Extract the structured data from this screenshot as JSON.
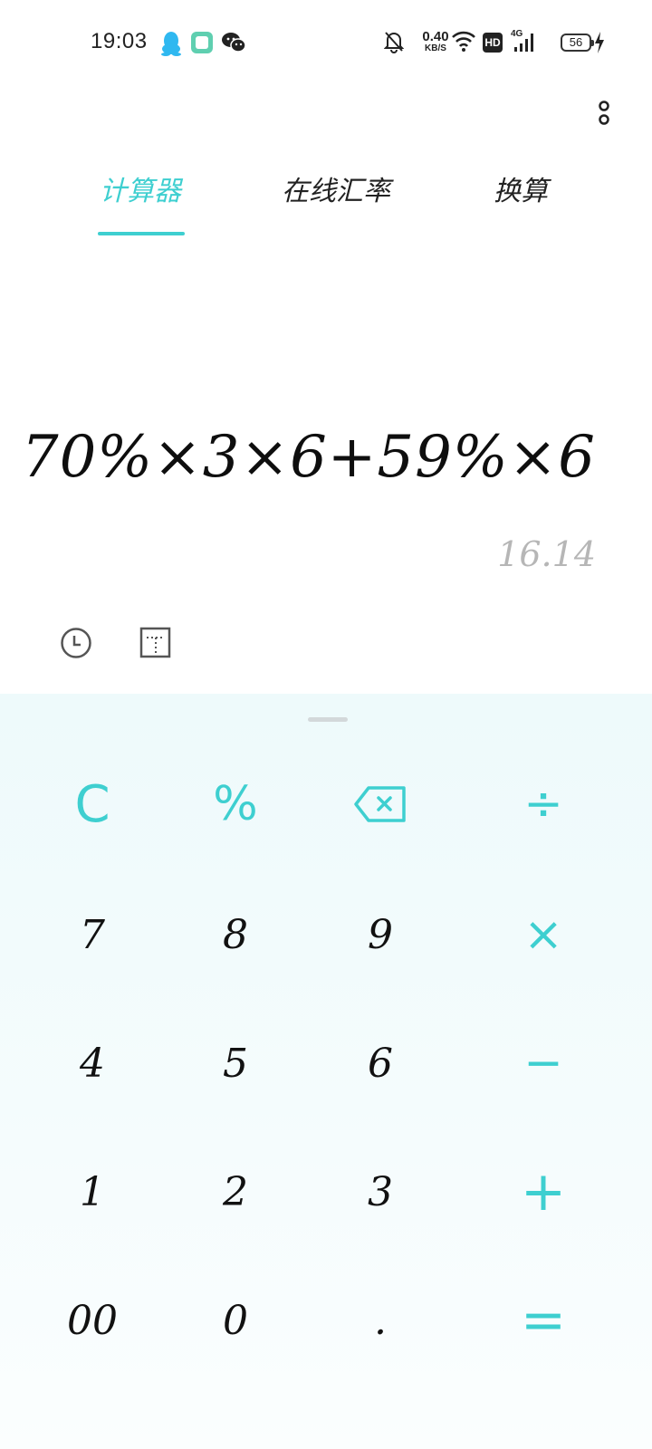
{
  "status_bar": {
    "time": "19:03",
    "net_speed_value": "0.40",
    "net_speed_unit": "KB/S",
    "hd_label": "HD",
    "network_label": "4G",
    "battery_level": "56"
  },
  "tabs": [
    {
      "label": "计算器",
      "active": true
    },
    {
      "label": "在线汇率",
      "active": false
    },
    {
      "label": "换算",
      "active": false
    }
  ],
  "display": {
    "expression": "70%×3×6+59%×6",
    "result": "16.14"
  },
  "keypad": {
    "rows": [
      [
        "C",
        "%",
        "backspace",
        "÷"
      ],
      [
        "7",
        "8",
        "9",
        "×"
      ],
      [
        "4",
        "5",
        "6",
        "−"
      ],
      [
        "1",
        "2",
        "3",
        "+"
      ],
      [
        "00",
        "0",
        ".",
        "="
      ]
    ]
  },
  "colors": {
    "accent": "#3ecfd0",
    "keypad_bg": "#eefafb",
    "result_text": "#b6b6b6"
  },
  "icons": {
    "more": "more-vertical-icon",
    "history": "clock-icon",
    "mode": "scientific-mode-icon",
    "backspace": "backspace-icon"
  }
}
